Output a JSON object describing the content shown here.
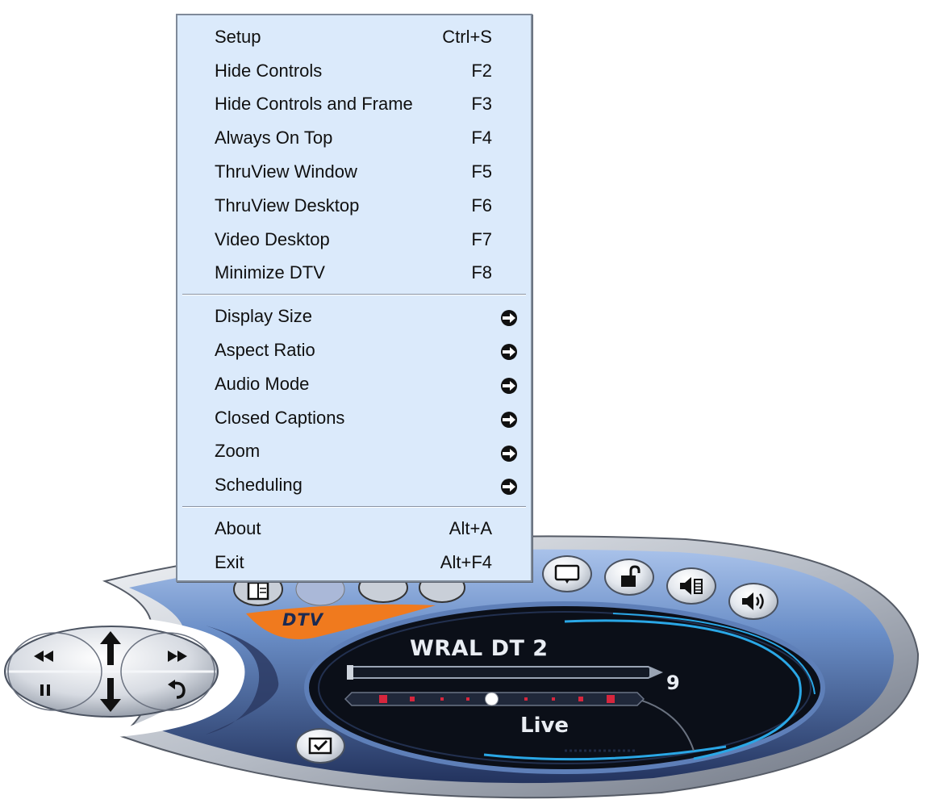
{
  "menu": {
    "group1": [
      {
        "label": "Setup",
        "shortcut": "Ctrl+S"
      },
      {
        "label": "Hide Controls",
        "shortcut": "F2"
      },
      {
        "label": "Hide Controls and Frame",
        "shortcut": "F3"
      },
      {
        "label": "Always On Top",
        "shortcut": "F4"
      },
      {
        "label": "ThruView Window",
        "shortcut": "F5"
      },
      {
        "label": "ThruView Desktop",
        "shortcut": "F6"
      },
      {
        "label": "Video Desktop",
        "shortcut": "F7"
      },
      {
        "label": "Minimize DTV",
        "shortcut": "F8"
      }
    ],
    "group2": [
      {
        "label": "Display Size",
        "icon": "submenu-arrow-icon"
      },
      {
        "label": "Aspect Ratio",
        "icon": "submenu-arrow-icon"
      },
      {
        "label": "Audio Mode",
        "icon": "submenu-arrow-icon"
      },
      {
        "label": "Closed Captions",
        "icon": "submenu-arrow-icon"
      },
      {
        "label": "Zoom",
        "icon": "submenu-arrow-icon"
      },
      {
        "label": "Scheduling",
        "icon": "submenu-arrow-icon"
      }
    ],
    "group3": [
      {
        "label": "About",
        "shortcut": "Alt+A"
      },
      {
        "label": "Exit",
        "shortcut": "Alt+F4"
      }
    ]
  },
  "player": {
    "brand": "DTV",
    "channel_name": "WRAL DT 2",
    "channel_number": "9",
    "status": "Live",
    "timeline_position": 0.49,
    "top_buttons": [
      "guide-icon",
      "display-icon",
      "lock-icon",
      "audio-channel-icon",
      "volume-icon"
    ],
    "transport_buttons": [
      "rewind-icon",
      "channel-up-icon",
      "fast-forward-icon",
      "pause-icon",
      "channel-down-icon",
      "return-icon"
    ],
    "check_button": "checkmark-icon"
  },
  "colors": {
    "menu_bg": "#dbeafb",
    "body_blue": "#6b8fc8",
    "screen_bg": "#0b0f18",
    "accent_orange": "#f07a1e",
    "marker_red": "#d7263d"
  }
}
